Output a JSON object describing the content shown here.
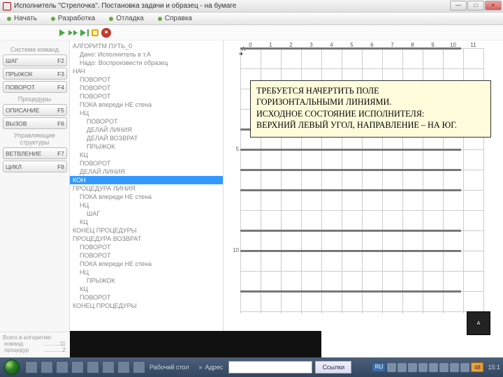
{
  "window": {
    "title": "Исполнитель \"Стрелочка\". Постановка задачи и образец - на бумаге"
  },
  "window_buttons": {
    "min": "—",
    "max": "□",
    "close": "×"
  },
  "menu": {
    "start": "Начать",
    "dev": "Разработка",
    "debug": "Отладка",
    "help": "Справка"
  },
  "left_panel": {
    "section1": "Система команд",
    "btn_shag": "ШАГ",
    "k_shag": "F2",
    "btn_prizhok": "ПРЫЖОК",
    "k_prizhok": "F3",
    "btn_povorot": "ПОВОРОТ",
    "k_povorot": "F4",
    "section2": "Процедуры",
    "btn_opisanie": "ОПИСАНИЕ",
    "k_opisanie": "F5",
    "btn_vyzov": "ВЫЗОВ",
    "k_vyzov": "F6",
    "section3": "Управляющие структуры",
    "btn_vetvl": "ВЕТВЛЕНИЕ",
    "k_vetvl": "F7",
    "btn_cikl": "ЦИКЛ",
    "k_cikl": "F8"
  },
  "code": [
    "АЛГОРИТМ ПУТЬ_0",
    "  Дано: Исполнитель в т.А",
    "  Надо: Воспроизвести образец",
    "НАЧ",
    "  ПОВОРОТ",
    "  ПОВОРОТ",
    "  ПОВОРОТ",
    "  ПОКА впереди НЕ стена",
    "  НЦ",
    "    ПОВОРОТ",
    "    ДЕЛАЙ ЛИНИЯ",
    "    ДЕЛАЙ ВОЗВРАТ",
    "    ПРЫЖОК",
    "  КЦ",
    "  ПОВОРОТ",
    "  ДЕЛАЙ ЛИНИЯ",
    "КОН",
    "ПРОЦЕДУРА ЛИНИЯ",
    "  ПОКА впереди НЕ стена",
    "  НЦ",
    "    ШАГ",
    "  КЦ",
    "КОНЕЦ ПРОЦЕДУРЫ",
    "ПРОЦЕДУРА ВОЗВРАТ",
    "  ПОВОРОТ",
    "  ПОВОРОТ",
    "  ПОКА впереди НЕ стена",
    "  НЦ",
    "    ПРЫЖОК",
    "  КЦ",
    "  ПОВОРОТ",
    "КОНЕЦ ПРОЦЕДУРЫ"
  ],
  "selected_line_index": 16,
  "grid": {
    "cols": [
      "0",
      "1",
      "2",
      "3",
      "4",
      "5",
      "6",
      "7",
      "8",
      "9",
      "10",
      "11"
    ],
    "rows_shown": [
      "5",
      "10"
    ],
    "start_label": "А"
  },
  "note": {
    "l1": "ТРЕБУЕТСЯ НАЧЕРТИТЬ ПОЛЕ",
    "l2": "ГОРИЗОНТАЛЬНЫМИ ЛИНИЯМИ.",
    "l3": "ИСХОДНОЕ СОСТОЯНИЕ ИСПОЛНИТЕЛЯ:",
    "l4": "ВЕРХНИЙ ЛЕВЫЙ УГОЛ, НАПРАВЛЕНИЕ – НА ЮГ."
  },
  "footer": {
    "title": "Всего в алгоритме:",
    "row1_label": "команд",
    "row1_val": "11",
    "row2_label": "процедур",
    "row2_val": "2"
  },
  "taskbar": {
    "desktop": "Рабочий стол",
    "address_label": "Адрес",
    "links_label": "Ссылки",
    "lang": "RU",
    "num": "48",
    "clock": "15:1"
  },
  "printer_label": "А"
}
